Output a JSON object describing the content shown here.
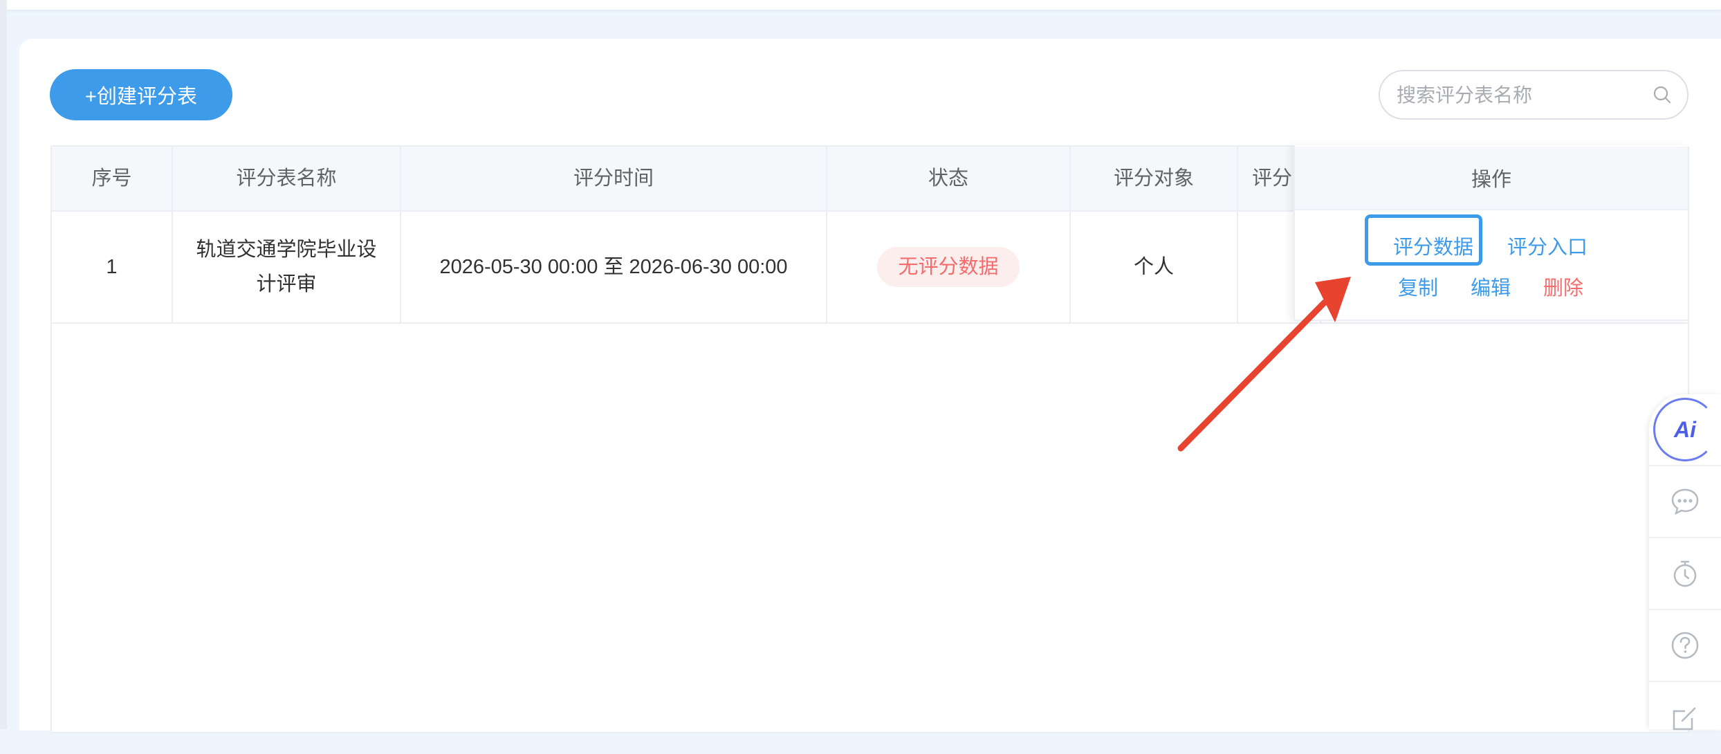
{
  "toolbar": {
    "create_label": "+创建评分表"
  },
  "search": {
    "placeholder": "搜索评分表名称",
    "value": ""
  },
  "table": {
    "headers": [
      "序号",
      "评分表名称",
      "评分时间",
      "状态",
      "评分对象",
      "评分",
      "操作"
    ],
    "rows": [
      {
        "index": "1",
        "name": "轨道交通学院毕业设计评审",
        "time": "2026-05-30 00:00 至 2026-06-30 00:00",
        "status": "无评分数据",
        "target": "个人",
        "extra": ""
      }
    ]
  },
  "actions": {
    "score_data": "评分数据",
    "score_entry": "评分入口",
    "copy": "复制",
    "edit": "编辑",
    "delete": "删除"
  },
  "side_tools": {
    "ai_label": "Ai",
    "icons": [
      "ai-icon",
      "chat-icon",
      "timer-icon",
      "help-icon",
      "edit-icon"
    ]
  },
  "colors": {
    "primary": "#3d9be9",
    "danger": "#f56c6c",
    "annotation_arrow": "#e8432f"
  }
}
